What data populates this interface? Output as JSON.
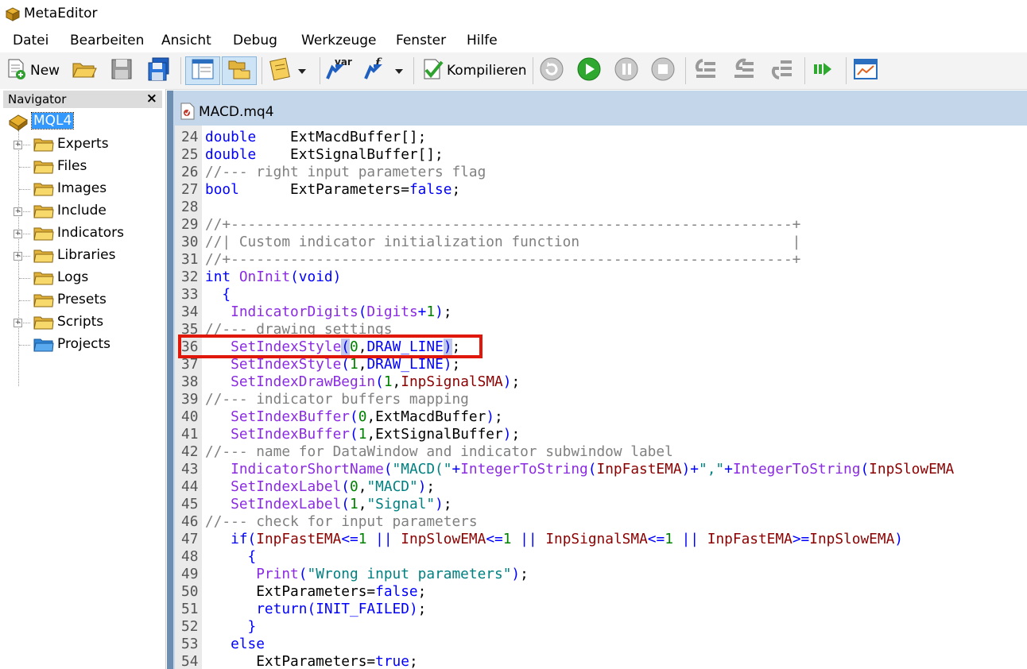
{
  "window": {
    "title": "MetaEditor"
  },
  "menu": [
    "Datei",
    "Bearbeiten",
    "Ansicht",
    "Debug",
    "Werkzeuge",
    "Fenster",
    "Hilfe"
  ],
  "toolbar": {
    "new_label": "New",
    "compile_label": "Kompilieren",
    "var_label": "var",
    "f_label": "f"
  },
  "navigator": {
    "title": "Navigator",
    "close": "×",
    "root": "MQL4",
    "items": [
      {
        "label": "Experts",
        "expandable": true
      },
      {
        "label": "Files",
        "expandable": false
      },
      {
        "label": "Images",
        "expandable": false
      },
      {
        "label": "Include",
        "expandable": true
      },
      {
        "label": "Indicators",
        "expandable": true
      },
      {
        "label": "Libraries",
        "expandable": true
      },
      {
        "label": "Logs",
        "expandable": false
      },
      {
        "label": "Presets",
        "expandable": false
      },
      {
        "label": "Scripts",
        "expandable": true
      },
      {
        "label": "Projects",
        "expandable": false
      }
    ]
  },
  "editor": {
    "tab_label": "MACD.mq4",
    "highlighted_line": 36,
    "lines": [
      {
        "n": "24",
        "tokens": [
          [
            "kw",
            "double"
          ],
          [
            "",
            "    ExtMacdBuffer[];"
          ]
        ]
      },
      {
        "n": "25",
        "tokens": [
          [
            "kw",
            "double"
          ],
          [
            "",
            "    ExtSignalBuffer[];"
          ]
        ]
      },
      {
        "n": "26",
        "tokens": [
          [
            "cm",
            "//--- right input parameters flag"
          ]
        ]
      },
      {
        "n": "27",
        "tokens": [
          [
            "kw",
            "bool"
          ],
          [
            "",
            "      ExtParameters="
          ],
          [
            "kw",
            "false"
          ],
          [
            "",
            ";"
          ]
        ]
      },
      {
        "n": "28",
        "tokens": []
      },
      {
        "n": "29",
        "tokens": [
          [
            "cm",
            "//+------------------------------------------------------------------+"
          ]
        ]
      },
      {
        "n": "30",
        "tokens": [
          [
            "cm",
            "//| Custom indicator initialization function                         |"
          ]
        ]
      },
      {
        "n": "31",
        "tokens": [
          [
            "cm",
            "//+------------------------------------------------------------------+"
          ]
        ]
      },
      {
        "n": "32",
        "tokens": [
          [
            "kw",
            "int"
          ],
          [
            "",
            " "
          ],
          [
            "fn",
            "OnInit"
          ],
          [
            "bl",
            "("
          ],
          [
            "kw",
            "void"
          ],
          [
            "bl",
            ")"
          ]
        ]
      },
      {
        "n": "33",
        "tokens": [
          [
            "bl",
            "  {"
          ]
        ]
      },
      {
        "n": "34",
        "tokens": [
          [
            "fn",
            "   IndicatorDigits"
          ],
          [
            "bl",
            "("
          ],
          [
            "fn",
            "Digits"
          ],
          [
            "bl",
            "+"
          ],
          [
            "num",
            "1"
          ],
          [
            "bl",
            ")"
          ],
          [
            "",
            ";"
          ]
        ]
      },
      {
        "n": "35",
        "tokens": [
          [
            "cm",
            "//--- drawing settings"
          ]
        ]
      },
      {
        "n": "36",
        "tokens": [
          [
            "fn",
            "   SetIndexStyle"
          ],
          [
            "hl",
            "("
          ],
          [
            "num",
            "0"
          ],
          [
            "",
            ","
          ],
          [
            "bl",
            "DRAW_LINE"
          ],
          [
            "hl",
            ")"
          ],
          [
            "",
            ";"
          ]
        ]
      },
      {
        "n": "37",
        "tokens": [
          [
            "fn",
            "   SetIndexStyle"
          ],
          [
            "bl",
            "("
          ],
          [
            "num",
            "1"
          ],
          [
            "",
            ","
          ],
          [
            "bl",
            "DRAW_LINE"
          ],
          [
            "bl",
            ")"
          ],
          [
            "",
            ";"
          ]
        ]
      },
      {
        "n": "38",
        "tokens": [
          [
            "fn",
            "   SetIndexDrawBegin"
          ],
          [
            "bl",
            "("
          ],
          [
            "num",
            "1"
          ],
          [
            "",
            ","
          ],
          [
            "id",
            "InpSignalSMA"
          ],
          [
            "bl",
            ")"
          ],
          [
            "",
            ";"
          ]
        ]
      },
      {
        "n": "39",
        "tokens": [
          [
            "cm",
            "//--- indicator buffers mapping"
          ]
        ]
      },
      {
        "n": "40",
        "tokens": [
          [
            "fn",
            "   SetIndexBuffer"
          ],
          [
            "bl",
            "("
          ],
          [
            "num",
            "0"
          ],
          [
            "",
            ",ExtMacdBuffer"
          ],
          [
            "bl",
            ")"
          ],
          [
            "",
            ";"
          ]
        ]
      },
      {
        "n": "41",
        "tokens": [
          [
            "fn",
            "   SetIndexBuffer"
          ],
          [
            "bl",
            "("
          ],
          [
            "num",
            "1"
          ],
          [
            "",
            ",ExtSignalBuffer"
          ],
          [
            "bl",
            ")"
          ],
          [
            "",
            ";"
          ]
        ]
      },
      {
        "n": "42",
        "tokens": [
          [
            "cm",
            "//--- name for DataWindow and indicator subwindow label"
          ]
        ]
      },
      {
        "n": "43",
        "tokens": [
          [
            "fn",
            "   IndicatorShortName"
          ],
          [
            "bl",
            "("
          ],
          [
            "str",
            "\"MACD(\""
          ],
          [
            "bl",
            "+"
          ],
          [
            "fn",
            "IntegerToString"
          ],
          [
            "bl",
            "("
          ],
          [
            "id",
            "InpFastEMA"
          ],
          [
            "bl",
            ")"
          ],
          [
            "bl",
            "+"
          ],
          [
            "str",
            "\",\""
          ],
          [
            "bl",
            "+"
          ],
          [
            "fn",
            "IntegerToString"
          ],
          [
            "bl",
            "("
          ],
          [
            "id",
            "InpSlowEMA"
          ]
        ]
      },
      {
        "n": "44",
        "tokens": [
          [
            "fn",
            "   SetIndexLabel"
          ],
          [
            "bl",
            "("
          ],
          [
            "num",
            "0"
          ],
          [
            "",
            ","
          ],
          [
            "str",
            "\"MACD\""
          ],
          [
            "bl",
            ")"
          ],
          [
            "",
            ";"
          ]
        ]
      },
      {
        "n": "45",
        "tokens": [
          [
            "fn",
            "   SetIndexLabel"
          ],
          [
            "bl",
            "("
          ],
          [
            "num",
            "1"
          ],
          [
            "",
            ","
          ],
          [
            "str",
            "\"Signal\""
          ],
          [
            "bl",
            ")"
          ],
          [
            "",
            ";"
          ]
        ]
      },
      {
        "n": "46",
        "tokens": [
          [
            "cm",
            "//--- check for input parameters"
          ]
        ]
      },
      {
        "n": "47",
        "tokens": [
          [
            "kw",
            "   if"
          ],
          [
            "bl",
            "("
          ],
          [
            "id",
            "InpFastEMA"
          ],
          [
            "bl",
            "<="
          ],
          [
            "num",
            "1"
          ],
          [
            "bl",
            " || "
          ],
          [
            "id",
            "InpSlowEMA"
          ],
          [
            "bl",
            "<="
          ],
          [
            "num",
            "1"
          ],
          [
            "bl",
            " || "
          ],
          [
            "id",
            "InpSignalSMA"
          ],
          [
            "bl",
            "<="
          ],
          [
            "num",
            "1"
          ],
          [
            "bl",
            " || "
          ],
          [
            "id",
            "InpFastEMA"
          ],
          [
            "bl",
            ">="
          ],
          [
            "id",
            "InpSlowEMA"
          ],
          [
            "bl",
            ")"
          ]
        ]
      },
      {
        "n": "48",
        "tokens": [
          [
            "bl",
            "     {"
          ]
        ]
      },
      {
        "n": "49",
        "tokens": [
          [
            "fn",
            "      Print"
          ],
          [
            "bl",
            "("
          ],
          [
            "str",
            "\"Wrong input parameters\""
          ],
          [
            "bl",
            ")"
          ],
          [
            "",
            ";"
          ]
        ]
      },
      {
        "n": "50",
        "tokens": [
          [
            "",
            "      ExtParameters="
          ],
          [
            "kw",
            "false"
          ],
          [
            "",
            ";"
          ]
        ]
      },
      {
        "n": "51",
        "tokens": [
          [
            "kw",
            "      return"
          ],
          [
            "bl",
            "("
          ],
          [
            "bl",
            "INIT_FAILED"
          ],
          [
            "bl",
            ")"
          ],
          [
            "",
            ";"
          ]
        ]
      },
      {
        "n": "52",
        "tokens": [
          [
            "bl",
            "     }"
          ]
        ]
      },
      {
        "n": "53",
        "tokens": [
          [
            "kw",
            "   else"
          ]
        ]
      },
      {
        "n": "54",
        "tokens": [
          [
            "",
            "      ExtParameters="
          ],
          [
            "kw",
            "true"
          ],
          [
            "",
            ";"
          ]
        ]
      }
    ]
  }
}
